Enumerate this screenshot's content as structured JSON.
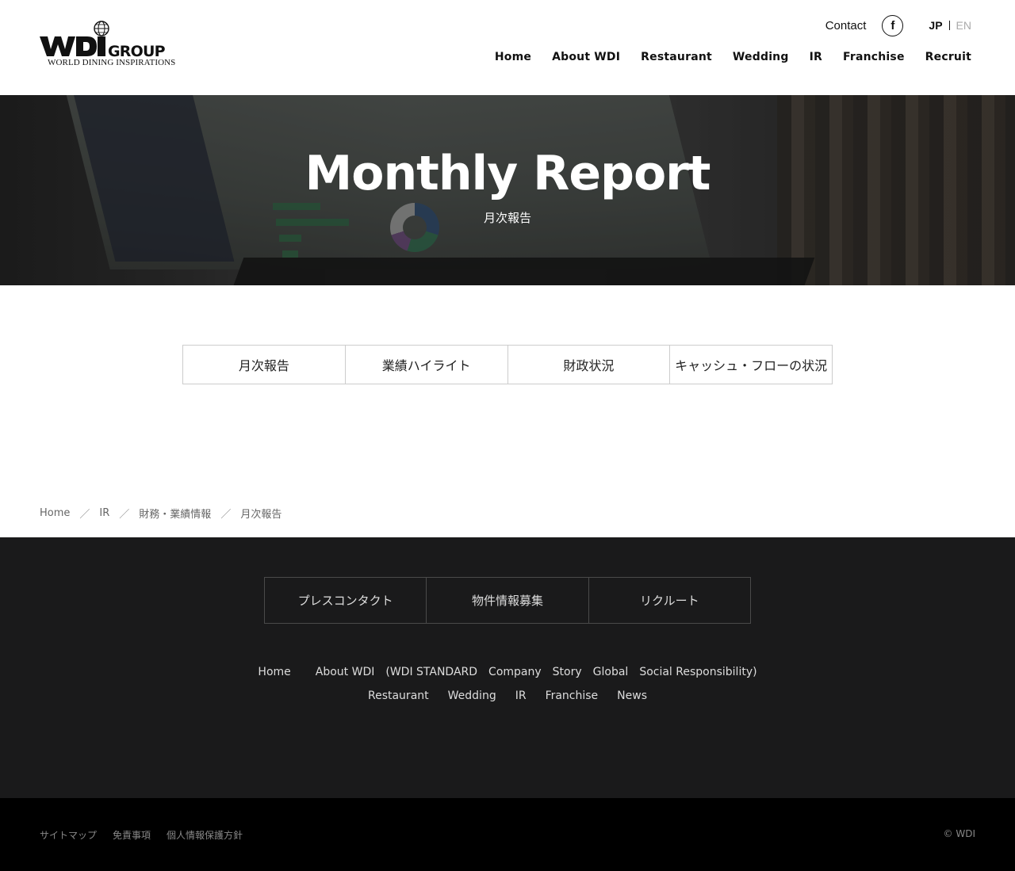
{
  "header": {
    "logo": {
      "brand": "WDI GROUP",
      "tagline": "WORLD DINING INSPIRATIONS"
    },
    "contact_label": "Contact",
    "facebook_glyph": "f",
    "lang": {
      "jp": "JP",
      "en": "EN"
    },
    "nav": [
      "Home",
      "About WDI",
      "Restaurant",
      "Wedding",
      "IR",
      "Franchise",
      "Recruit"
    ]
  },
  "hero": {
    "title": "Monthly Report",
    "subtitle": "月次報告"
  },
  "tabs": [
    "月次報告",
    "業績ハイライト",
    "財政状況",
    "キャッシュ・フローの状況"
  ],
  "breadcrumb": [
    "Home",
    "IR",
    "財務・業績情報",
    "月次報告"
  ],
  "breadcrumb_separator": "／",
  "footer": {
    "buttons": [
      "プレスコンタクト",
      "物件情報募集",
      "リクルート"
    ],
    "links_row1": [
      "Home",
      "About WDI",
      "(WDI STANDARD",
      "Company",
      "Story",
      "Global",
      "Social Responsibility)"
    ],
    "links_row2": [
      "Restaurant",
      "Wedding",
      "IR",
      "Franchise",
      "News"
    ]
  },
  "bottom": {
    "links": [
      "サイトマップ",
      "免責事項",
      "個人情報保護方針"
    ],
    "copyright": "© WDI"
  }
}
